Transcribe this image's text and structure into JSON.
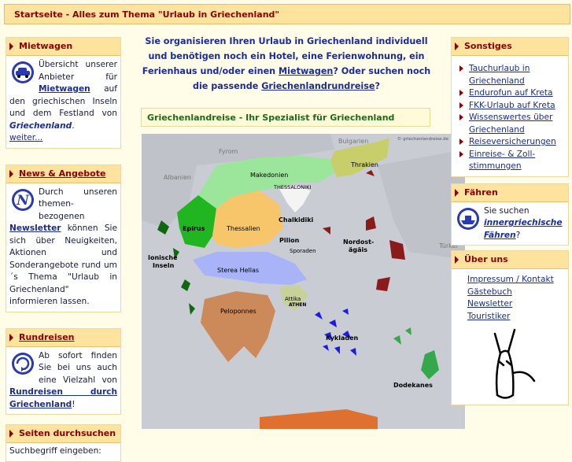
{
  "header": {
    "title": "Startseite - Alles zum Thema \"Urlaub in Griechenland\""
  },
  "left": {
    "mietwagen": {
      "heading": "Mietwagen",
      "text1": "Übersicht unserer Anbieter für",
      "link": "Mietwagen",
      "text2": "auf den griechischen Inseln und dem Festland von",
      "emph": "Griechenland",
      "text3": ".",
      "more": "weiter..."
    },
    "news": {
      "heading": "News & Angebote",
      "text1": "Durch unseren themen-bezogenen",
      "link": "Newsletter",
      "text2": "können Sie sich über Neuigkeiten, Aktionen und Sonderangebote rund um´s Thema \"Urlaub in Griechenland\" informieren lassen."
    },
    "rundreisen": {
      "heading": "Rundreisen",
      "text1": "Ab sofort finden Sie bei uns auch eine Vielzahl von",
      "link": "Rundreisen durch Griechenland",
      "text2": "!"
    },
    "search": {
      "heading": "Seiten durchsuchen",
      "label": "Suchbegriff eingeben:"
    }
  },
  "center": {
    "intro1": "Sie organisieren Ihren Urlaub in Griechenland individuell und benötigen noch ein Hotel, eine Ferienwohnung, ein Ferienhaus und/oder einen",
    "intro_link1": "Mietwagen",
    "intro2": "? Oder suchen noch die passende",
    "intro_link2": "Griechenlandrundreise",
    "intro3": "?",
    "specialist": "Griechenlandreise - Ihr Spezialist für Griechenland"
  },
  "map": {
    "copyright": "© griechenlandreise.de",
    "labels": {
      "pyrom": "Fyrom",
      "bulgarien": "Bulgarien",
      "albanien": "Albanien",
      "turkei": "Türkei",
      "makedonien": "Makedonien",
      "thessaloniki": "THESSALONIKI",
      "thrakien": "Thrakien",
      "chalkidiki": "Chalkidiki",
      "epirus": "Epirus",
      "thessalien": "Thessalien",
      "pilion": "Pilion",
      "sporaden": "Sporaden",
      "nordost": "Nordost-",
      "agais": "ägäis",
      "ionische": "Ionische",
      "inseln": "Inseln",
      "sterea": "Sterea Hellas",
      "attika": "Attika",
      "athen": "ATHEN",
      "peloponnes": "Peloponnes",
      "kykladen": "Kykladen",
      "dodekanes": "Dodekanes"
    }
  },
  "right": {
    "sonstiges": {
      "heading": "Sonstiges",
      "links": [
        "Tauchurlaub in Griechenland",
        "Endurofun auf Kreta",
        "FKK-Urlaub auf Kreta",
        "Wissenswertes über Griechenland",
        "Reiseversicherungen",
        "Einreise- & Zoll-stimmungen"
      ]
    },
    "faehren": {
      "heading": "Fähren",
      "text1": "Sie suchen",
      "link": "innergriechische Fähren",
      "text2": "?"
    },
    "ueberuns": {
      "heading": "Über uns",
      "links": [
        "Impressum / Kontakt",
        "Gästebuch",
        "Newsletter",
        "Touristiker"
      ]
    }
  },
  "colors": {
    "header_bg": "#fde39d",
    "heading_text": "#8b0000",
    "link": "#1a2ca0",
    "green_heading": "#1a6b1a",
    "page_bg": "#fffde8"
  }
}
